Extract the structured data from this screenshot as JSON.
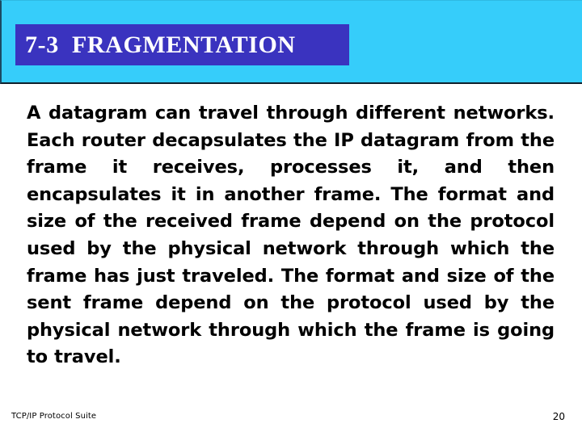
{
  "slide": {
    "header": {
      "title": "7-3  FRAGMENTATION",
      "banner_color": "#36cdfa",
      "title_box_color": "#3a33bf",
      "title_text_color": "#ffffff"
    },
    "body": {
      "paragraph": "A datagram can travel through different networks. Each router decapsulates the IP datagram from the frame it receives, processes it, and then encapsulates it in another frame. The format and size of the received frame depend on the protocol used by the physical network through which the frame has just traveled. The format and size of the sent frame depend on the protocol used by the physical network through which the frame is going to travel."
    },
    "footer": {
      "source": "TCP/IP Protocol Suite",
      "page_number": "20"
    }
  }
}
